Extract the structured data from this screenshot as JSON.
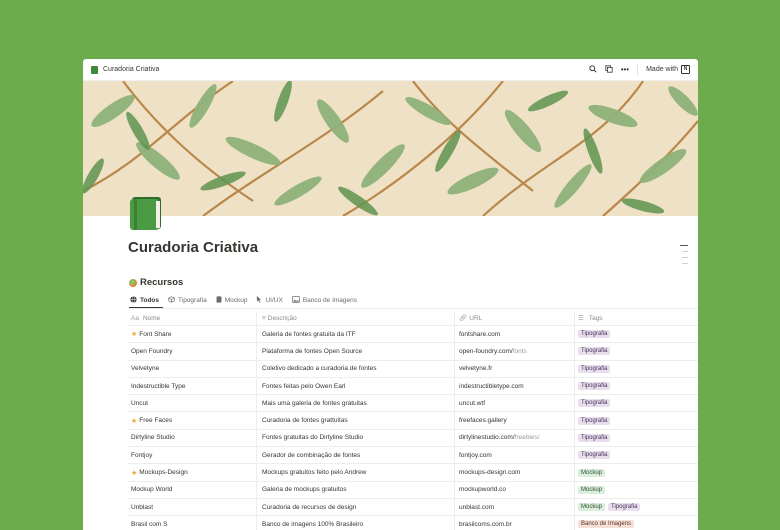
{
  "topbar": {
    "title": "Curadoria Criativa",
    "made_with": "Made with"
  },
  "page": {
    "title": "Curadoria Criativa",
    "section_title": "Recursos"
  },
  "tabs": [
    {
      "label": "Todos"
    },
    {
      "label": "Tipografia"
    },
    {
      "label": "Mockup"
    },
    {
      "label": "UI/UX"
    },
    {
      "label": "Banco de Imagens"
    }
  ],
  "table": {
    "headers": {
      "name": "Nome",
      "desc": "Descrição",
      "url": "URL",
      "tags": "Tags"
    },
    "rows": [
      {
        "name": "Font Share",
        "star": true,
        "desc": "Galeria de fontes gratuita da ITF",
        "url": "fontshare.com",
        "url_suffix": "",
        "tags": [
          "Tipografia"
        ]
      },
      {
        "name": "Open Foundry",
        "star": false,
        "desc": "Plataforma de fontes Open Source",
        "url": "open-foundry.com/",
        "url_suffix": "fonts",
        "tags": [
          "Tipografia"
        ]
      },
      {
        "name": "Velvetyne",
        "star": false,
        "desc": "Coletivo dedicado a curadoria de fontes",
        "url": "velvetyne.fr",
        "url_suffix": "",
        "tags": [
          "Tipografia"
        ]
      },
      {
        "name": "Indestructible Type",
        "star": false,
        "desc": "Fontes feitas pelo Owen Earl",
        "url": "indestructibletype.com",
        "url_suffix": "",
        "tags": [
          "Tipografia"
        ]
      },
      {
        "name": "Uncut",
        "star": false,
        "desc": "Mais uma galeria de fontes gratuitas",
        "url": "uncut.wtf",
        "url_suffix": "",
        "tags": [
          "Tipografia"
        ]
      },
      {
        "name": "Free Faces",
        "star": true,
        "desc": "Curadoria de fontes grattuitas",
        "url": "freefaces.gallery",
        "url_suffix": "",
        "tags": [
          "Tipografia"
        ]
      },
      {
        "name": "Dirtyline Studio",
        "star": false,
        "desc": "Fontes gratuitas do Dirtyline Studio",
        "url": "dirtylinestudio.com/",
        "url_suffix": "freebies/",
        "tags": [
          "Tipografia"
        ]
      },
      {
        "name": "Fontjoy",
        "star": false,
        "desc": "Gerador de combinação de fontes",
        "url": "fontjoy.com",
        "url_suffix": "",
        "tags": [
          "Tipografia"
        ]
      },
      {
        "name": "Mockups-Design",
        "star": true,
        "desc": "Mockups gratuitos feito pelo Andrew",
        "url": "mockups-design.com",
        "url_suffix": "",
        "tags": [
          "Mockup"
        ]
      },
      {
        "name": "Mockup World",
        "star": false,
        "desc": "Galeria de mockups gratuitos",
        "url": "mockupworld.co",
        "url_suffix": "",
        "tags": [
          "Mockup"
        ]
      },
      {
        "name": "Unblast",
        "star": false,
        "desc": "Curadoria de recursos de design",
        "url": "unblast.com",
        "url_suffix": "",
        "tags": [
          "Mockup",
          "Tipografia"
        ]
      },
      {
        "name": "Brasil com S",
        "star": false,
        "desc": "Banco de imagens 100% Brasileiro",
        "url": "brasilcoms.com.br",
        "url_suffix": "",
        "tags": [
          "Banco de Imagens"
        ]
      }
    ]
  },
  "colors": {
    "background": "#6cac4c",
    "tag_tipografia": "#e8deee",
    "tag_mockup": "#dbeddb",
    "tag_banco": "#f5e0d7"
  }
}
